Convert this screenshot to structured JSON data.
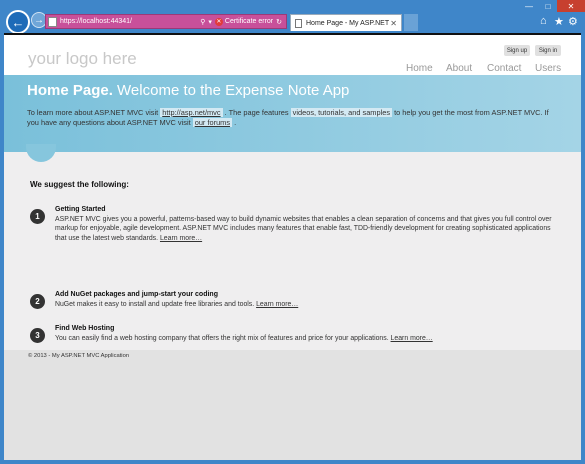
{
  "browser": {
    "url": "https://localhost:44341/",
    "cert_error": "Certificate error",
    "tab_title": "Home Page - My ASP.NET ..."
  },
  "site": {
    "logo": "your logo here",
    "signup": "Sign up",
    "signin": "Sign in",
    "menu": {
      "home": "Home",
      "about": "About",
      "contact": "Contact",
      "users": "Users"
    }
  },
  "featured": {
    "title_bold": "Home Page.",
    "title_rest": " Welcome to the Expense Note App",
    "text1": "To learn more about ASP.NET MVC visit ",
    "link1": "http://asp.net/mvc",
    "text2": " . The page features ",
    "highlight": "videos, tutorials, and samples",
    "text3": " to help you get the most from ASP.NET MVC. If you have any questions about ASP.NET MVC visit ",
    "link2": "our forums",
    "text4": " ."
  },
  "main": {
    "suggest": "We suggest the following:",
    "steps": [
      {
        "num": "1",
        "title": "Getting Started",
        "desc": "ASP.NET MVC gives you a powerful, patterns-based way to build dynamic websites that enables a clean separation of concerns and that gives you full control over markup for enjoyable, agile development. ASP.NET MVC includes many features that enable fast, TDD-friendly development for creating sophisticated applications that use the latest web standards. ",
        "more": "Learn more…"
      },
      {
        "num": "2",
        "title": "Add NuGet packages and jump-start your coding",
        "desc": "NuGet makes it easy to install and update free libraries and tools. ",
        "more": "Learn more…"
      },
      {
        "num": "3",
        "title": "Find Web Hosting",
        "desc": "You can easily find a web hosting company that offers the right mix of features and price for your applications. ",
        "more": "Learn more…"
      }
    ]
  },
  "footer": {
    "copyright": "© 2013 - My ASP.NET MVC Application"
  }
}
